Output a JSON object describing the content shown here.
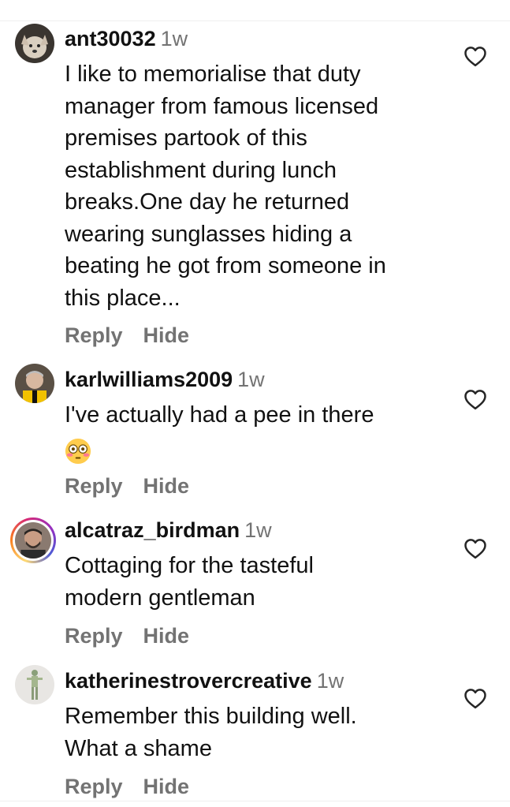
{
  "comments": [
    {
      "username": "ant30032",
      "time": "1w",
      "text": "I like to memorialise that duty manager from famous licensed premises partook of this establishment during lunch breaks.One day he returned wearing sunglasses hiding a beating he got from someone in this place...",
      "lines": [
        "I like to memorialise that duty",
        "manager from famous licensed",
        "premises partook of this",
        "establishment during lunch",
        "breaks.One day he returned",
        "wearing sunglasses hiding a",
        "beating he got from someone in",
        "this place..."
      ],
      "reply_label": "Reply",
      "hide_label": "Hide",
      "avatar_icon": "dog-avatar"
    },
    {
      "username": "karlwilliams2009",
      "time": "1w",
      "lines": [
        "I've actually had a pee in there"
      ],
      "emoji": "flushed-face-emoji",
      "reply_label": "Reply",
      "hide_label": "Hide",
      "avatar_icon": "man-avatar"
    },
    {
      "username": "alcatraz_birdman",
      "time": "1w",
      "lines": [
        "Cottaging for the tasteful",
        "modern gentleman"
      ],
      "reply_label": "Reply",
      "hide_label": "Hide",
      "avatar_icon": "man-beard-avatar",
      "has_story_ring": true
    },
    {
      "username": "katherinestrovercreative",
      "time": "1w",
      "lines": [
        "Remember this building well.",
        "What a shame"
      ],
      "reply_label": "Reply",
      "hide_label": "Hide",
      "avatar_icon": "figure-avatar"
    }
  ],
  "colors": {
    "text": "#111111",
    "muted": "#737373",
    "like_outline": "#262626",
    "story_ring": "#d62976"
  },
  "icons": {
    "like": "heart-outline-icon"
  }
}
